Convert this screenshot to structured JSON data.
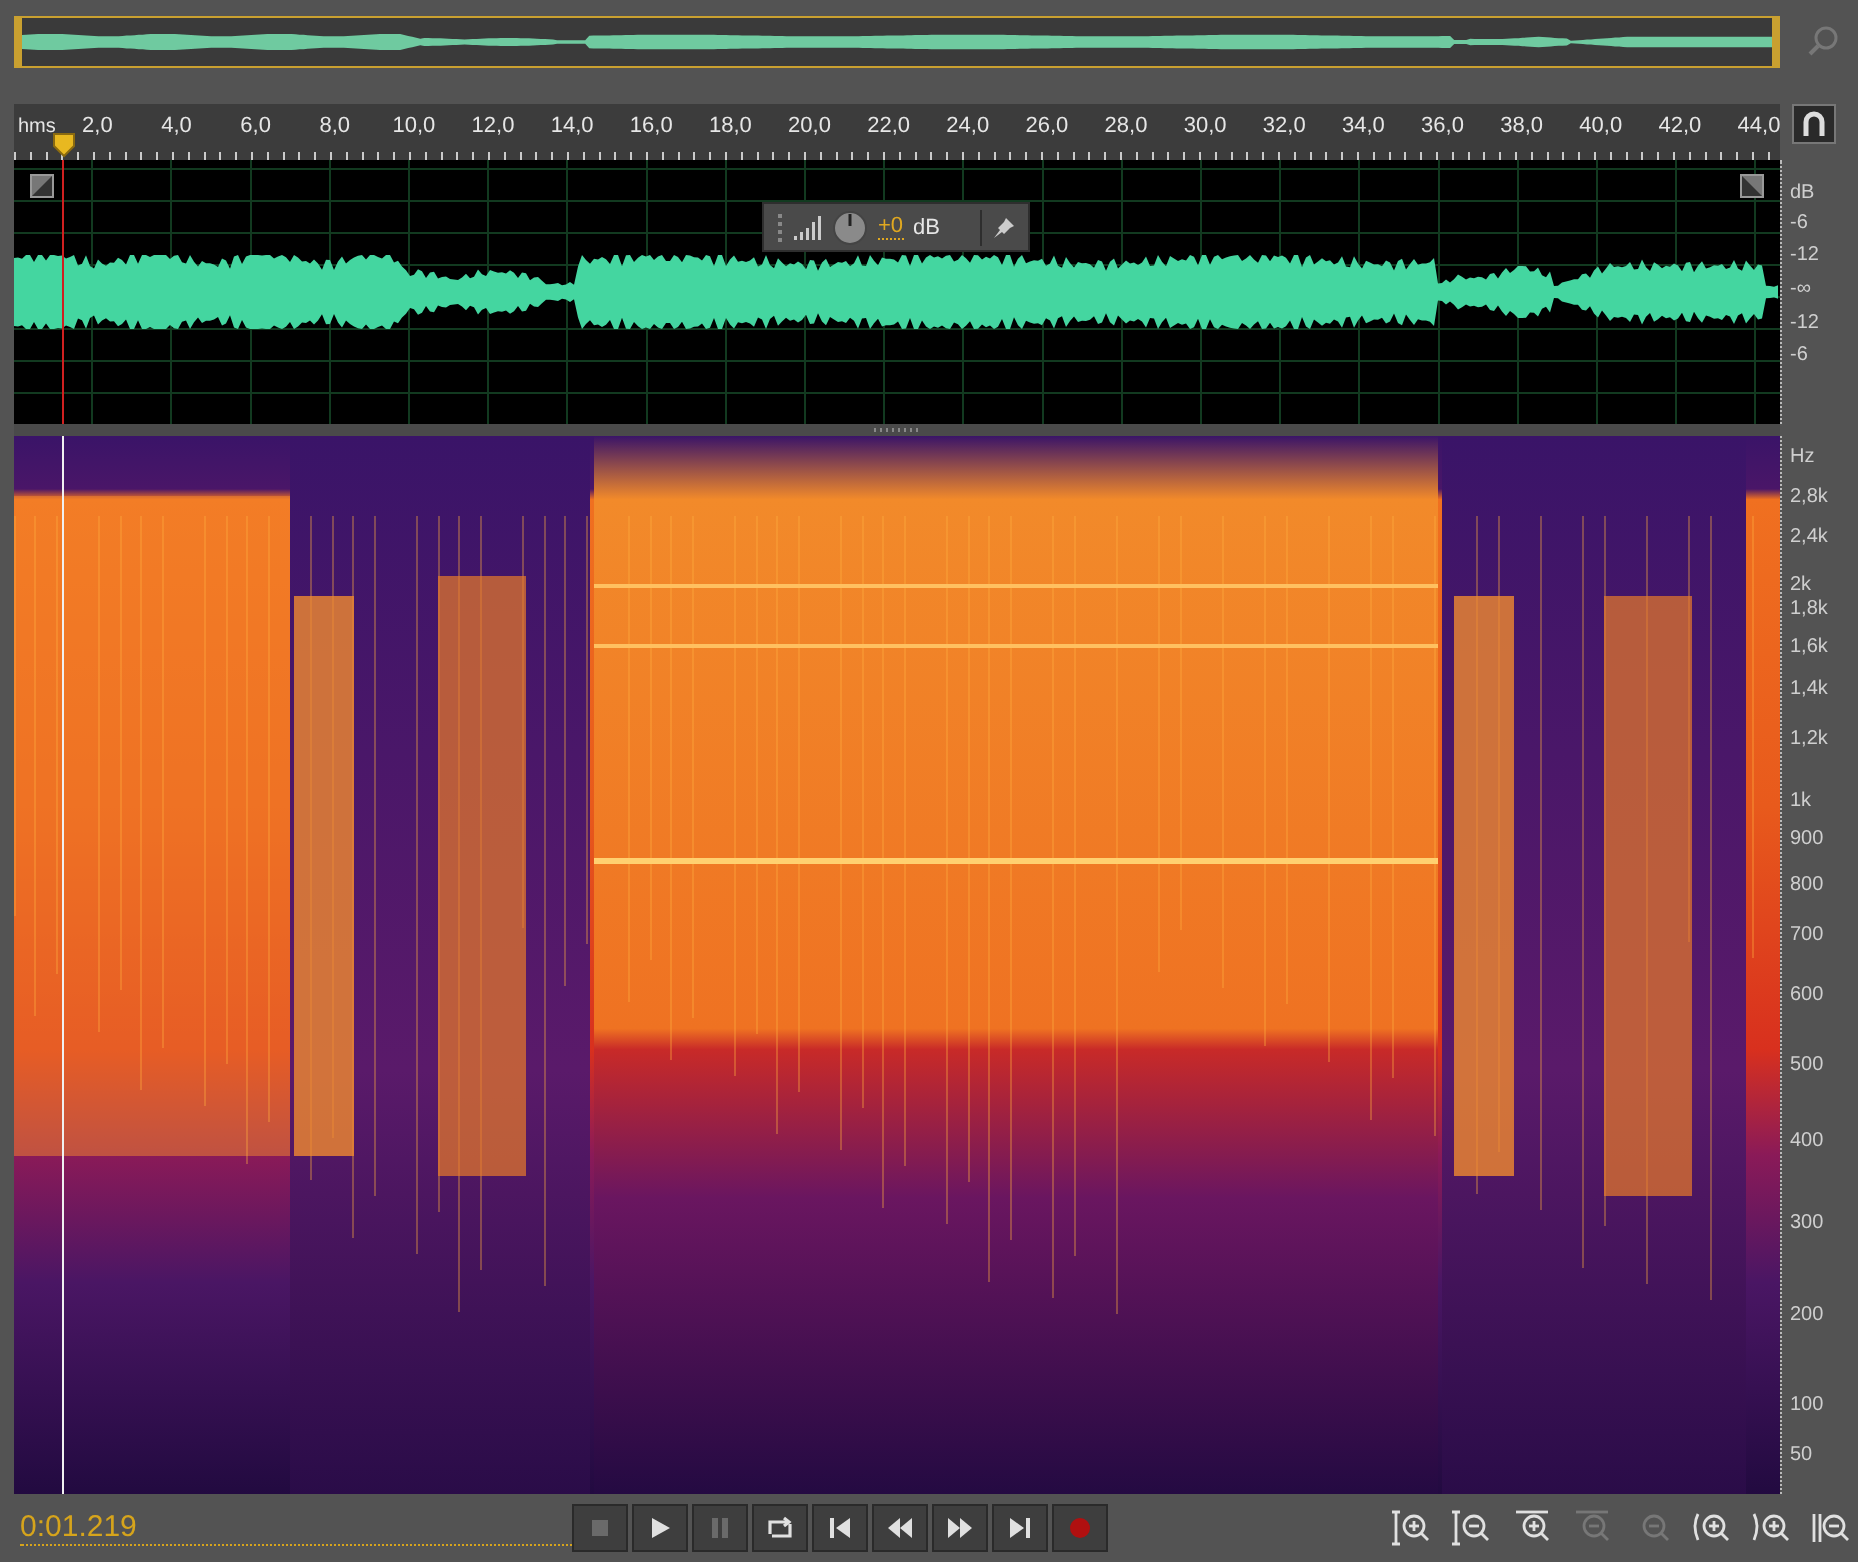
{
  "timeline": {
    "unit": "hms",
    "ticks": [
      "2,0",
      "4,0",
      "6,0",
      "8,0",
      "10,0",
      "12,0",
      "14,0",
      "16,0",
      "18,0",
      "20,0",
      "22,0",
      "24,0",
      "26,0",
      "28,0",
      "30,0",
      "32,0",
      "34,0",
      "36,0",
      "38,0",
      "40,0",
      "42,0",
      "44,0"
    ]
  },
  "volume_hud": {
    "value": "+0",
    "unit": "dB"
  },
  "amplitude_scale": {
    "unit": "dB",
    "labels": [
      "-6",
      "-12",
      "-∞",
      "-12",
      "-6"
    ]
  },
  "frequency_scale": {
    "unit": "Hz",
    "labels": [
      "2,8k",
      "2,4k",
      "2k",
      "1,8k",
      "1,6k",
      "1,4k",
      "1,2k",
      "1k",
      "900",
      "800",
      "700",
      "600",
      "500",
      "400",
      "300",
      "200",
      "100",
      "50"
    ]
  },
  "status": {
    "time": "0:01.219"
  },
  "transport": [
    {
      "kind": "stop",
      "disabled": true
    },
    {
      "kind": "play",
      "disabled": false
    },
    {
      "kind": "pause",
      "disabled": true
    },
    {
      "kind": "loop",
      "disabled": false
    },
    {
      "kind": "to-start",
      "disabled": false
    },
    {
      "kind": "rewind",
      "disabled": false
    },
    {
      "kind": "fast-forward",
      "disabled": false
    },
    {
      "kind": "to-end",
      "disabled": false
    },
    {
      "kind": "record",
      "disabled": false
    }
  ],
  "zoom_tools": [
    {
      "kind": "zoom-in-amplitude",
      "disabled": false
    },
    {
      "kind": "zoom-out-amplitude",
      "disabled": false
    },
    {
      "kind": "zoom-in-time",
      "disabled": false
    },
    {
      "kind": "zoom-out-full",
      "disabled": true
    },
    {
      "kind": "zoom-selection",
      "disabled": true
    },
    {
      "kind": "zoom-in-start",
      "disabled": false
    },
    {
      "kind": "zoom-in-end",
      "disabled": false
    },
    {
      "kind": "zoom-cut",
      "disabled": false
    }
  ]
}
